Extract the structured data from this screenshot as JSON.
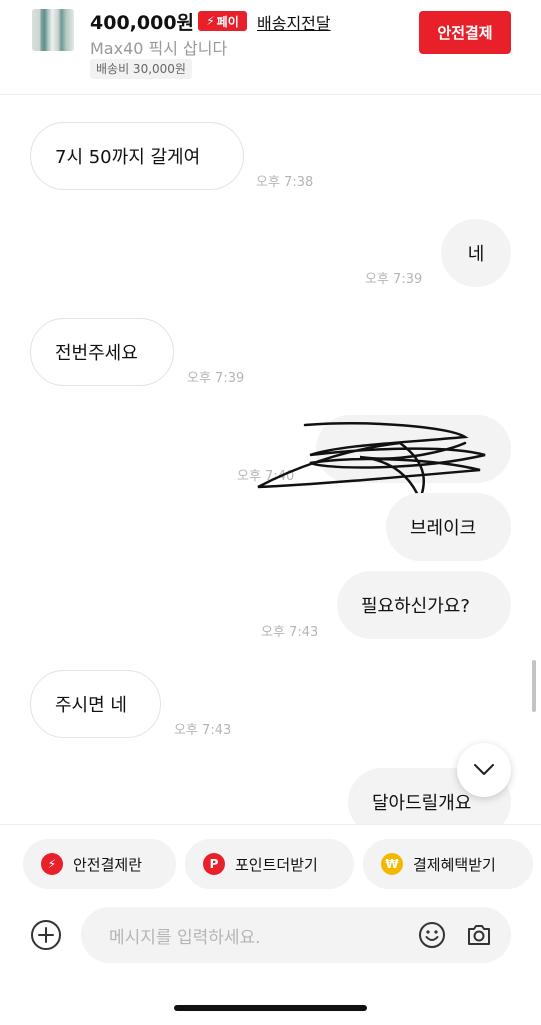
{
  "header": {
    "price": "400,000원",
    "pay_badge": "페이",
    "delivery_link": "배송지전달",
    "subtitle": "Max40 픽시 삽니다",
    "shipping_fee": "배송비 30,000원",
    "safe_pay_button": "안전결제"
  },
  "messages": [
    {
      "side": "in",
      "text": "7시 50까지 갈게여",
      "time": "오후 7:38"
    },
    {
      "side": "out",
      "text": "네",
      "time": "오후 7:39"
    },
    {
      "side": "in",
      "text": "전번주세요",
      "time": "오후 7:39"
    },
    {
      "side": "out",
      "text": "",
      "time": "오후 7:40",
      "redacted": true
    },
    {
      "side": "out",
      "text": "브레이크",
      "time": ""
    },
    {
      "side": "out",
      "text": "필요하신가요?",
      "time": "오후 7:43"
    },
    {
      "side": "in",
      "text": "주시면 네",
      "time": "오후 7:43"
    },
    {
      "side": "out",
      "text": "달아드릴개요",
      "time": ""
    }
  ],
  "quick_actions": [
    {
      "label": "안전결제란",
      "icon": "lightning-icon",
      "color": "#e8202a"
    },
    {
      "label": "포인트더받기",
      "icon": "point-p-icon",
      "color": "#e8202a"
    },
    {
      "label": "결제혜택받기",
      "icon": "coin-icon",
      "color": "#f5b800"
    }
  ],
  "composer": {
    "placeholder": "메시지를 입력하세요."
  },
  "colors": {
    "accent": "#e8202a",
    "bubble_out": "#f3f3f3",
    "timestamp": "#b5b5b5"
  }
}
